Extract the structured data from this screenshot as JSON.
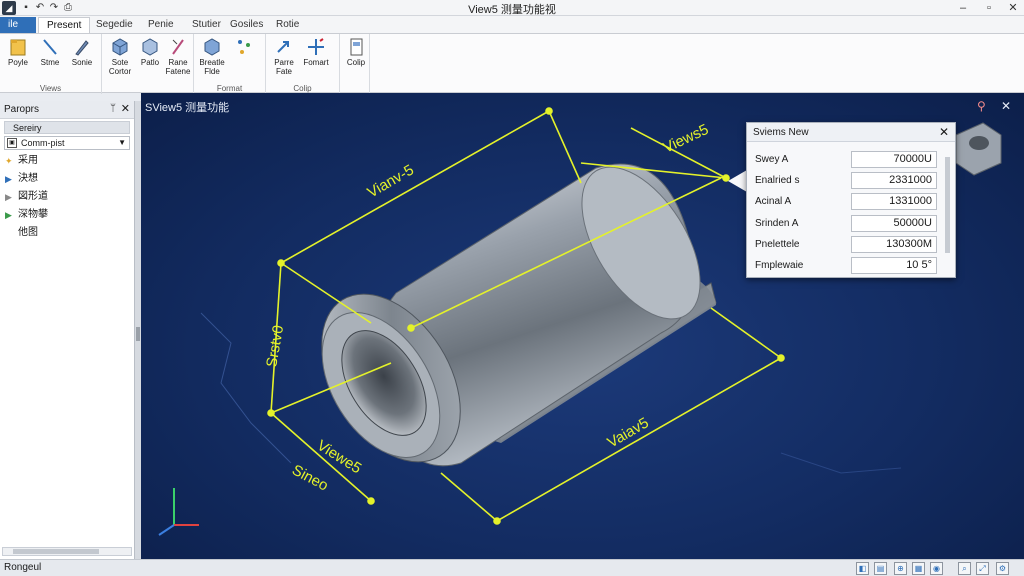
{
  "window": {
    "title": "View5 测量功能视",
    "quick_access": [
      "save-icon",
      "undo-icon",
      "redo-icon",
      "print-icon"
    ]
  },
  "ribbon": {
    "tabs": [
      {
        "label": "ile"
      },
      {
        "label": "Present"
      },
      {
        "label": "Segedie"
      },
      {
        "label": "Penie"
      },
      {
        "label": "Stutier"
      },
      {
        "label": "Gosiles"
      },
      {
        "label": "Rotie"
      }
    ],
    "groups": [
      {
        "label": "Views",
        "buttons": [
          {
            "label": "Poyle",
            "icon": "folder-icon"
          },
          {
            "label": "Stme",
            "icon": "line-icon"
          },
          {
            "label": "Sonie",
            "icon": "pen-icon"
          }
        ]
      },
      {
        "label": "",
        "buttons": [
          {
            "label": "Sote Cortor",
            "icon": "cube-icon"
          },
          {
            "label": "Patlo",
            "icon": "cube-icon"
          },
          {
            "label": "Rane Fatene",
            "icon": "ruler-icon"
          }
        ]
      },
      {
        "label": "Format",
        "buttons": [
          {
            "label": "Breatle Flde",
            "icon": "cube-icon"
          },
          {
            "label": "",
            "icon": "measure-icon"
          }
        ]
      },
      {
        "label": "Colip",
        "buttons": [
          {
            "label": "Parre Fate",
            "icon": "arrow-icon"
          },
          {
            "label": "Fomart",
            "icon": "move-icon"
          }
        ]
      },
      {
        "label": "",
        "buttons": [
          {
            "label": "Colip",
            "icon": "document-icon"
          }
        ]
      }
    ]
  },
  "left_panel": {
    "title": "Paroprs",
    "section": "Sereiry",
    "combo_value": "Comm-pist",
    "items": [
      {
        "label": "采用",
        "icon": "star-icon"
      },
      {
        "label": "決想",
        "icon": "triangle-blue"
      },
      {
        "label": "図形道",
        "icon": "triangle-gray"
      },
      {
        "label": "深物攀",
        "icon": "triangle-green"
      },
      {
        "label": "他图",
        "icon": ""
      }
    ]
  },
  "viewport": {
    "title": "SView5 测量功能",
    "dimension_labels": [
      "Vianv-5",
      "Views5",
      "Srstv0",
      "Viewe5",
      "Sineo",
      "Vaiav5"
    ]
  },
  "dialog": {
    "title": "Sviems New",
    "rows": [
      {
        "key": "Swey A",
        "value": "70000U"
      },
      {
        "key": "Enalried s",
        "value": "2331000"
      },
      {
        "key": "Acinal A",
        "value": "1331000"
      },
      {
        "key": "Srinden A",
        "value": "50000U"
      },
      {
        "key": "Pnelettele",
        "value": "130300M"
      },
      {
        "key": "Fmplewaie",
        "value": "10 5°"
      }
    ]
  },
  "statusbar": {
    "text": "Rongeul"
  },
  "colors": {
    "accent": "#2f6fb8",
    "dimension": "#e4f22a",
    "viewport_bg": "#132c62"
  }
}
